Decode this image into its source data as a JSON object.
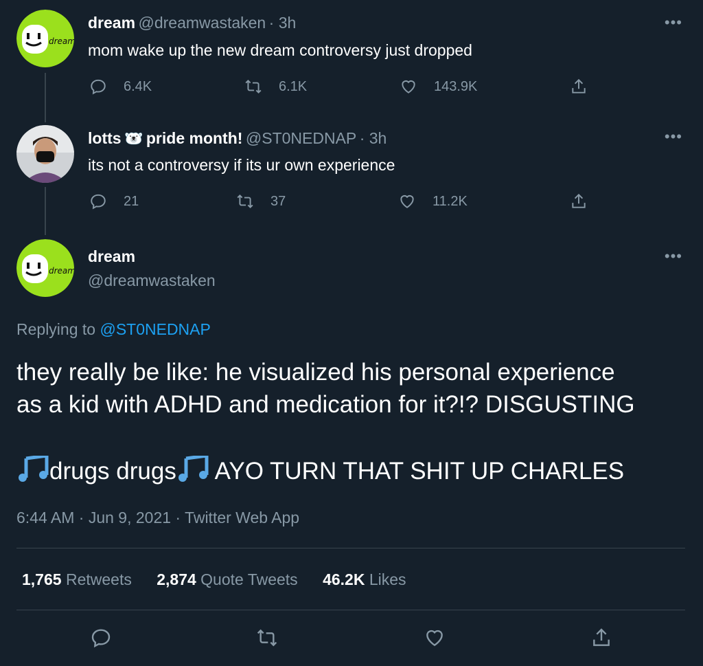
{
  "tweet1": {
    "name": "dream",
    "handle": "@dreamwastaken",
    "time": "· 3h",
    "text": "mom wake up the new dream controversy just dropped",
    "avatar_label": "dream",
    "replies": "6.4K",
    "retweets": "6.1K",
    "likes": "143.9K"
  },
  "tweet2": {
    "name": "lotts 🐻‍❄️ pride month!",
    "name_text": "lotts",
    "name_suffix": "pride month!",
    "handle": "@ST0NEDNAP",
    "time": "· 3h",
    "text": "its not a controversy if its ur own experience",
    "replies": "21",
    "retweets": "37",
    "likes": "11.2K"
  },
  "main_tweet": {
    "name": "dream",
    "handle": "@dreamwastaken",
    "avatar_label": "dream",
    "replying_prefix": "Replying to",
    "replying_to": "@ST0NEDNAP",
    "text_line1": "they really be like: he visualized his personal experience",
    "text_line2": "as a kid with ADHD and medication for it?!? DISGUSTING",
    "text_line3_a": "drugs drugs",
    "text_line3_b": " AYO TURN THAT SHIT UP CHARLES",
    "timestamp": "6:44 AM · Jun 9, 2021 · Twitter Web App",
    "stats": {
      "retweets_count": "1,765",
      "retweets_label": "Retweets",
      "quotes_count": "2,874",
      "quotes_label": "Quote Tweets",
      "likes_count": "46.2K",
      "likes_label": "Likes"
    }
  },
  "more_label": "•••",
  "colors": {
    "background": "#15202b",
    "muted": "#8899a6",
    "link": "#1da1f2",
    "avatar_green": "#9be01d",
    "divider": "#38444d"
  }
}
